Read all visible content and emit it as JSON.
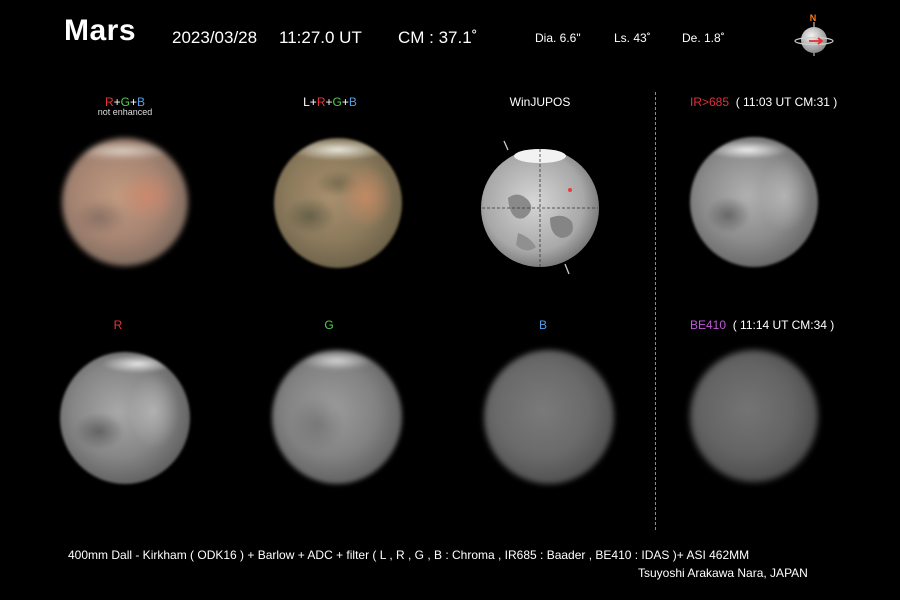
{
  "header": {
    "title": "Mars",
    "date": "2023/03/28",
    "time": "11:27.0 UT",
    "cm": "CM : 37.1˚",
    "dia": "Dia. 6.6\"",
    "ls": "Ls. 43˚",
    "de": "De. 1.8˚",
    "north_label": "N"
  },
  "panels": {
    "rgb": {
      "r": "R",
      "plus1": "+",
      "g": "G",
      "plus2": "+",
      "b": "B",
      "note": "not enhanced"
    },
    "lrgb": {
      "l": "L+",
      "r": "R",
      "plus1": "+",
      "g": "G",
      "plus2": "+",
      "b": "B"
    },
    "winjupos": "WinJUPOS",
    "ir": {
      "filter": "IR>685",
      "info": "( 11:03 UT  CM:31 )"
    },
    "r": "R",
    "g": "G",
    "b": "B",
    "be": {
      "filter": "BE410",
      "info": "( 11:14 UT  CM:34 )"
    }
  },
  "footer": {
    "equipment": "400mm Dall - Kirkham ( ODK16 ) +  Barlow  +  ADC  +  filter (  L , R , G , B : Chroma   ,  IR685 : Baader  ,  BE410 : IDAS  )+  ASI 462MM",
    "observer": "Tsuyoshi   Arakawa     Nara, JAPAN"
  },
  "colors": {
    "red": "#e8343a",
    "green": "#4fd050",
    "blue": "#4fa0e8",
    "violet": "#c058d8"
  }
}
